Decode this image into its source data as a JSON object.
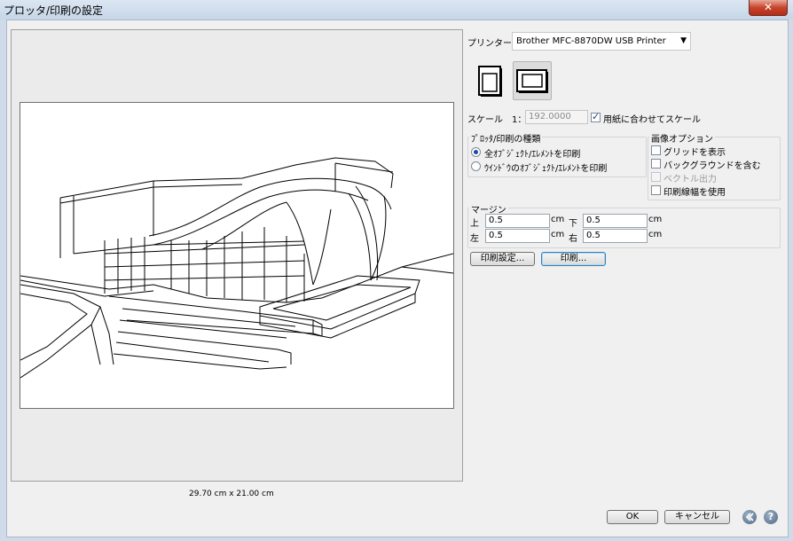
{
  "window": {
    "title": "プロッタ/印刷の設定",
    "close_label": "✕"
  },
  "preview": {
    "paper_size": "29.70 cm x 21.00 cm"
  },
  "printer": {
    "label": "プリンター:",
    "selected": "Brother MFC-8870DW USB Printer"
  },
  "scale": {
    "label": "スケール　1：",
    "value": "192.0000",
    "fit_label": "用紙に合わせてスケール",
    "fit_checked": true
  },
  "plot_type": {
    "title": "ﾌﾟﾛｯﾀ/印刷の種類",
    "options": [
      {
        "label": "全ｵﾌﾞｼﾞｪｸﾄ/ｴﾚﾒﾝﾄを印刷",
        "selected": true
      },
      {
        "label": "ｳｲﾝﾄﾞｳのｵﾌﾞｼﾞｪｸﾄ/ｴﾚﾒﾝﾄを印刷",
        "selected": false
      }
    ]
  },
  "image_options": {
    "title": "画像オプション",
    "items": [
      {
        "label": "グリッドを表示",
        "checked": false,
        "enabled": true
      },
      {
        "label": "バックグラウンドを含む",
        "checked": false,
        "enabled": true
      },
      {
        "label": "ベクトル出力",
        "checked": false,
        "enabled": false
      },
      {
        "label": "印刷線幅を使用",
        "checked": false,
        "enabled": true
      }
    ]
  },
  "margins": {
    "title": "マージン",
    "top_label": "上",
    "top_value": "0.5",
    "bottom_label": "下",
    "bottom_value": "0.5",
    "left_label": "左",
    "left_value": "0.5",
    "right_label": "右",
    "right_value": "0.5",
    "unit": "cm"
  },
  "buttons": {
    "print_setup": "印刷設定...",
    "print": "印刷...",
    "ok": "OK",
    "cancel": "キャンセル"
  },
  "icons": {
    "collapse": "double-chevron-left-icon",
    "help": "question-mark-icon"
  }
}
